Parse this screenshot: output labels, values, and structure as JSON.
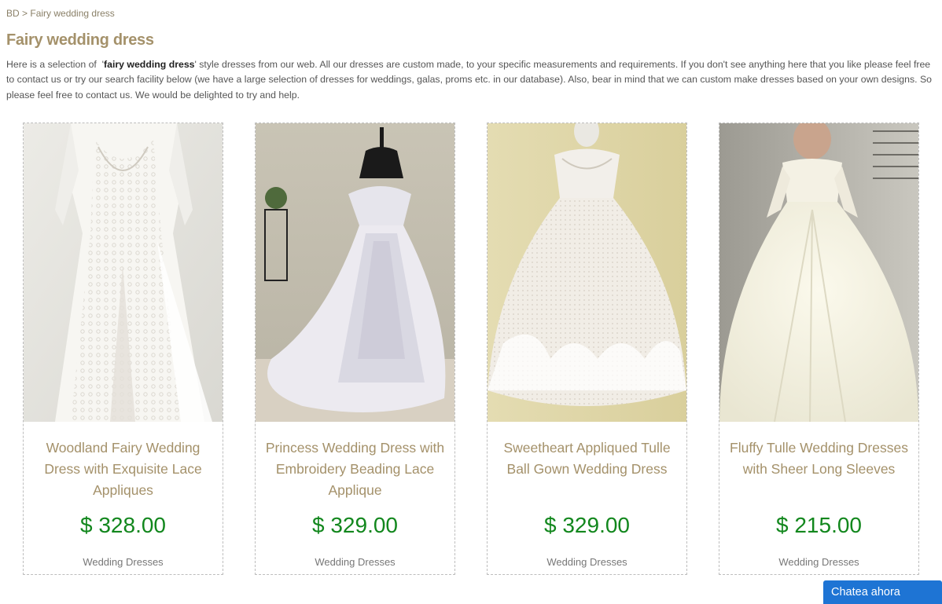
{
  "breadcrumb": {
    "home": "BD",
    "separator": " > ",
    "current": "Fairy wedding dress"
  },
  "page": {
    "title": "Fairy wedding dress",
    "intro_before": "Here is a selection of  '",
    "intro_keyword": "fairy wedding dress",
    "intro_after": "' style dresses from our web. All our dresses are custom made, to your specific measurements and requirements. If you don't see anything here that you like please feel free to contact us or try our search facility below (we have a large selection of dresses for weddings, galas, proms etc. in our database). Also, bear in mind that we can custom make dresses based on your own designs. So please feel free to contact us. We would be delighted to try and help."
  },
  "products": [
    {
      "name": "Woodland Fairy Wedding Dress with Exquisite Lace Appliques",
      "price": "$ 328.00",
      "category": "Wedding Dresses"
    },
    {
      "name": "Princess Wedding Dress with Embroidery Beading Lace Applique",
      "price": "$ 329.00",
      "category": "Wedding Dresses"
    },
    {
      "name": "Sweetheart Appliqued Tulle Ball Gown Wedding Dress",
      "price": "$ 329.00",
      "category": "Wedding Dresses"
    },
    {
      "name": "Fluffy Tulle Wedding Dresses with Sheer Long Sleeves",
      "price": "$ 215.00",
      "category": "Wedding Dresses"
    }
  ],
  "chat": {
    "label": "Chatea ahora"
  },
  "colors": {
    "title": "#a4916a",
    "price": "#12871d",
    "chat": "#1e74d4"
  }
}
